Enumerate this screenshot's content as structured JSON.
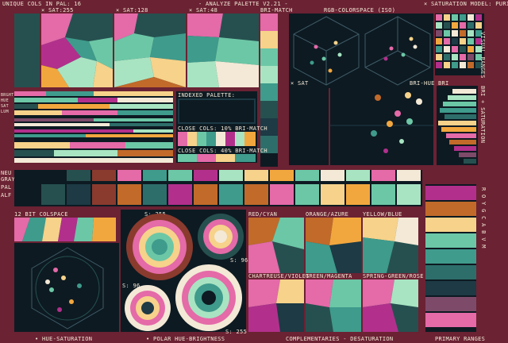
{
  "header": {
    "unique_cols": "UNIQUE COLS IN PAL: 16",
    "title": "- ANALYZE PALETTE V2.21 -",
    "model": "× SATURATION MODEL: PURIST"
  },
  "labels": {
    "sat255": "× SAT:255",
    "sat128": "× SAT:128",
    "sat48": "× SAT:48",
    "bri_match_top": "BRI-MATCH",
    "rgb_colorspace": "RGB-COLORSPACE (ISO)",
    "visual_ranges": "VISUAL RANGES",
    "bri_sat": "BRI + SATURATION",
    "x_sat": "× SAT",
    "bri_hue": "BRI-HUE",
    "bri": "BRI",
    "indexed_palette": "INDEXED PALETTE:",
    "close_cols_10": "CLOSE COLS: 10% BRI-MATCH",
    "close_cols_40": "CLOSE COLS: 40% BRI-MATCH",
    "row_labels": [
      "BRGHT",
      "HUE",
      "SAT",
      "LUM"
    ],
    "neu": "NEU",
    "gray": "GRAY",
    "pal": "PAL",
    "alf": "ALF",
    "colspace12": "12 BIT COLSPACE",
    "s255a": "S: 255",
    "s96a": "S: 96",
    "s96b": "S: 96",
    "s255b": "S: 255",
    "red_cyan": "RED/CYAN",
    "orange_azure": "ORANGE/AZURE",
    "yellow_blue": "YELLOW/BLUE",
    "chartreuse_violet": "CHARTREUSE/VIOLET",
    "green_magenta": "GREEN/MAGENTA",
    "spring_rose": "SPRING-GREEN/ROSE",
    "roygbiv": "R O Y G C A B V M",
    "footer_hue_sat": "• HUE-SATURATION",
    "footer_polar": "• POLAR HUE-BRIGHTNESS",
    "footer_comp": "COMPLEMENTARIES - DESATURATION",
    "footer_primary": "PRIMARY RANGES"
  },
  "palette": [
    "#0d1a22",
    "#1d3a45",
    "#26504f",
    "#2e6e6a",
    "#3f9b8c",
    "#6cc7a6",
    "#a8e4c2",
    "#f3e9d6",
    "#f6d28a",
    "#f2a73e",
    "#c16a2a",
    "#8a3b2e",
    "#e46aa8",
    "#b2308c",
    "#6b2233",
    "#7d4a6a"
  ]
}
